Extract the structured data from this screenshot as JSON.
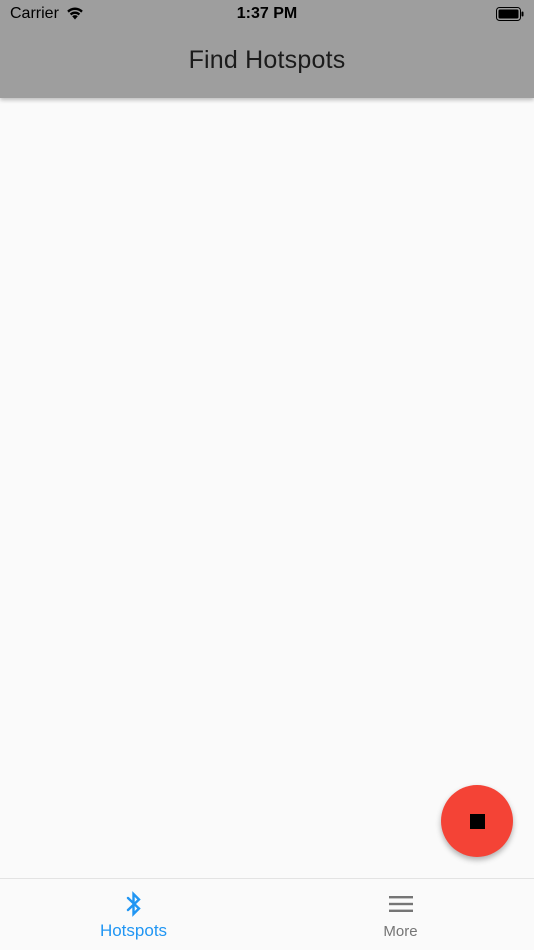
{
  "status_bar": {
    "carrier": "Carrier",
    "time": "1:37 PM",
    "wifi_icon": "wifi-icon",
    "battery_icon": "battery-icon"
  },
  "app_bar": {
    "title": "Find Hotspots",
    "background": "#9e9e9e"
  },
  "fab": {
    "icon": "stop-icon",
    "color": "#f44336"
  },
  "bottom_nav": {
    "items": [
      {
        "label": "Hotspots",
        "icon": "bluetooth-icon",
        "active": true,
        "color": "#2196f3"
      },
      {
        "label": "More",
        "icon": "menu-icon",
        "active": false,
        "color": "#757575"
      }
    ]
  }
}
